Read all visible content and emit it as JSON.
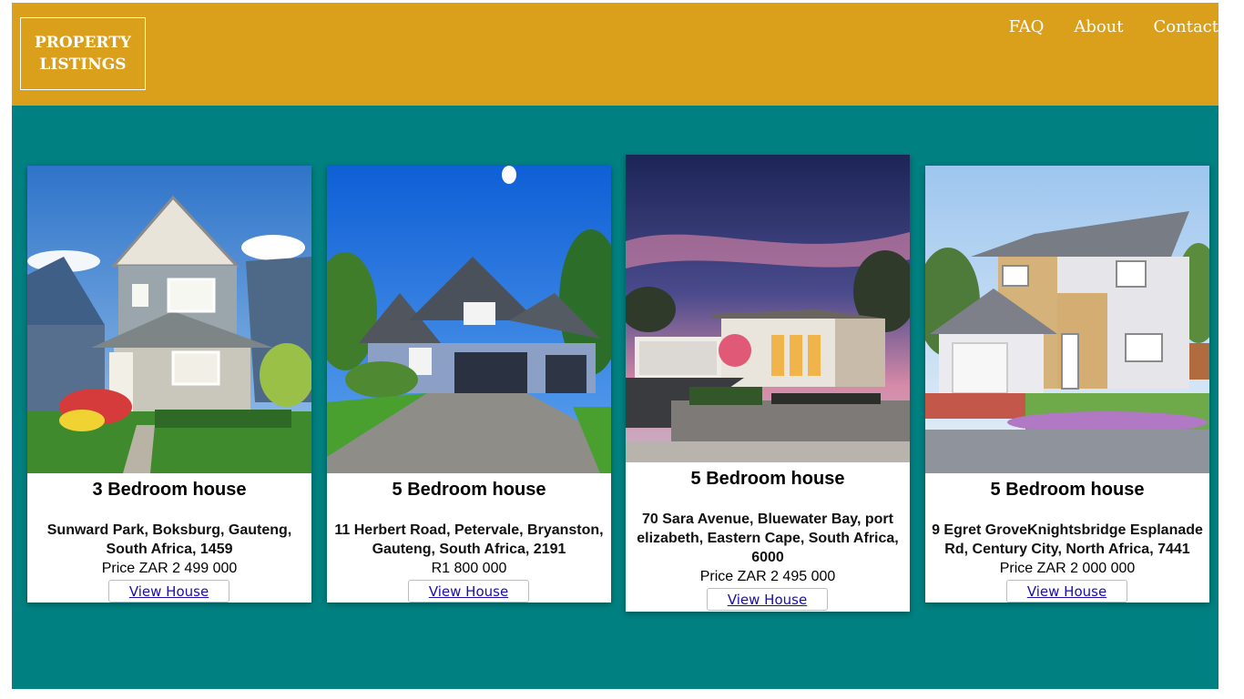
{
  "header": {
    "logo_line1": "PROPERTY",
    "logo_line2": "LISTINGS",
    "background": "#DAA01B",
    "nav": [
      "FAQ",
      "About",
      "Contact"
    ]
  },
  "page": {
    "background": "#008080"
  },
  "listings": [
    {
      "title": "3 Bedroom house",
      "address": "Sunward Park, Boksburg, Gauteng, South Africa, 1459",
      "price": "Price ZAR 2 499 000",
      "button": "View House",
      "image": "two-storey-house-photo"
    },
    {
      "title": "5 Bedroom house",
      "address": "11 Herbert Road, Petervale, Bryanston, Gauteng, South Africa, 2191",
      "price": "R1 800 000",
      "button": "View House",
      "image": "house-with-double-garage-photo"
    },
    {
      "title": "5 Bedroom house",
      "address": "70 Sara Avenue, Bluewater Bay, port elizabeth, Eastern Cape, South Africa, 6000",
      "price": "Price ZAR 2 495 000",
      "button": "View House",
      "image": "modern-house-at-dusk-photo"
    },
    {
      "title": "5 Bedroom house",
      "address": "9 Egret GroveKnightsbridge Esplanade Rd, Century City, North Africa, 7441",
      "price": "Price ZAR 2 000 000",
      "button": "View House",
      "image": "brick-house-with-garage-photo"
    }
  ]
}
